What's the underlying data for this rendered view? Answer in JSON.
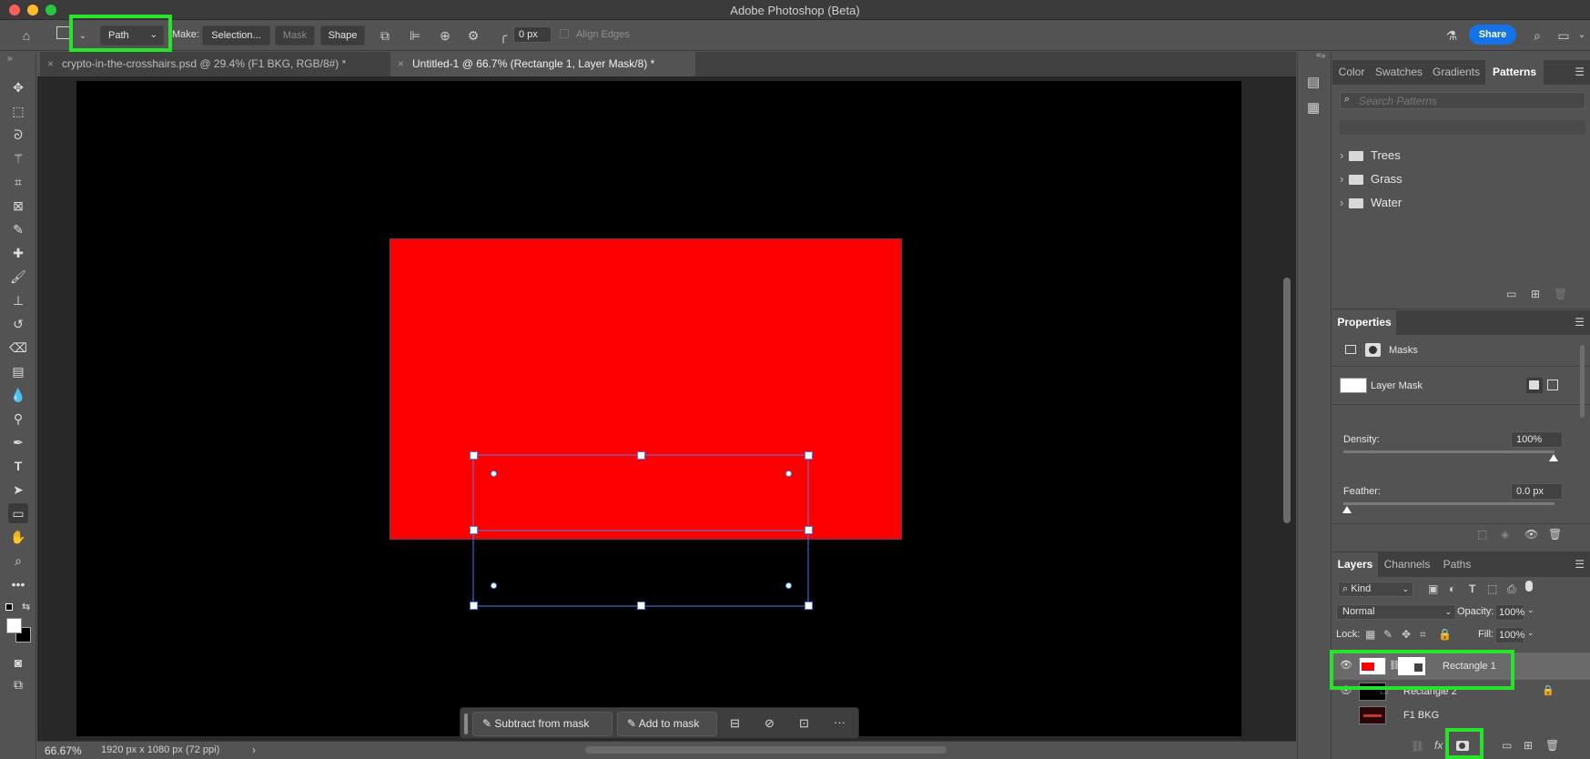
{
  "app": {
    "title": "Adobe Photoshop (Beta)"
  },
  "colors": {
    "accent_green": "#27e32b",
    "canvas_red": "#fe0000",
    "share_blue": "#1473e6"
  },
  "options_bar": {
    "mode_value": "Path",
    "make_label": "Make:",
    "selection_button": "Selection...",
    "mask_button": "Mask",
    "shape_button": "Shape",
    "radius_value": "0 px",
    "align_edges_label": "Align Edges",
    "share_button": "Share"
  },
  "tabs": [
    {
      "label": "crypto-in-the-crosshairs.psd @ 29.4% (F1 BKG, RGB/8#) *"
    },
    {
      "label": "Untitled-1 @ 66.7% (Rectangle 1, Layer Mask/8) *"
    }
  ],
  "context_bar": {
    "subtract_label": "Subtract from mask",
    "add_label": "Add to mask",
    "more_label": "···"
  },
  "status": {
    "zoom": "66.67%",
    "doc_info": "1920 px x 1080 px (72 ppi)"
  },
  "patterns_panel": {
    "tabs": [
      "Color",
      "Swatches",
      "Gradients",
      "Patterns"
    ],
    "search_placeholder": "Search Patterns",
    "folders": [
      "Trees",
      "Grass",
      "Water"
    ]
  },
  "properties_panel": {
    "title": "Properties",
    "masks_label": "Masks",
    "layer_mask_label": "Layer Mask",
    "density_label": "Density:",
    "density_value": "100%",
    "feather_label": "Feather:",
    "feather_value": "0.0 px"
  },
  "layers_panel": {
    "tabs": [
      "Layers",
      "Channels",
      "Paths"
    ],
    "kind_label": "Kind",
    "blend_mode": "Normal",
    "opacity_label": "Opacity:",
    "opacity_value": "100%",
    "lock_label": "Lock:",
    "fill_label": "Fill:",
    "fill_value": "100%",
    "layers": [
      {
        "name": "Rectangle 1",
        "visible": true
      },
      {
        "name": "Rectangle 2",
        "visible": true
      },
      {
        "name": "F1 BKG",
        "visible": false
      }
    ]
  }
}
